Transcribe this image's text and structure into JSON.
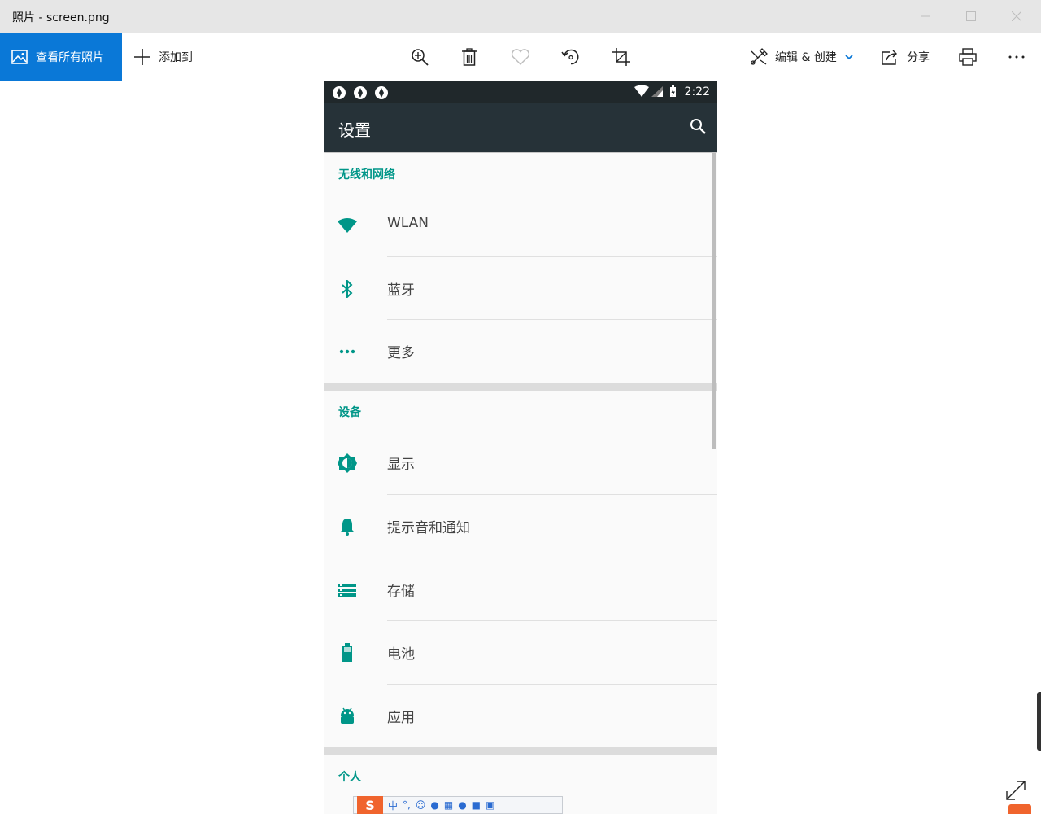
{
  "window": {
    "title": "照片 - screen.png"
  },
  "toolbar": {
    "view_all": "查看所有照片",
    "add_to": "添加到",
    "edit_create": "编辑 & 创建",
    "share": "分享"
  },
  "phone": {
    "status_time": "2:22",
    "app_title": "设置",
    "sections": [
      {
        "title": "无线和网络",
        "items": [
          "WLAN",
          "蓝牙",
          "更多"
        ]
      },
      {
        "title": "设备",
        "items": [
          "显示",
          "提示音和通知",
          "存储",
          "电池",
          "应用"
        ]
      },
      {
        "title": "个人"
      }
    ],
    "accent_color": "#009688",
    "appbar_color": "#263238"
  },
  "ime": {
    "mode": "中"
  },
  "colors": {
    "photos_accent": "#0a78d7"
  }
}
